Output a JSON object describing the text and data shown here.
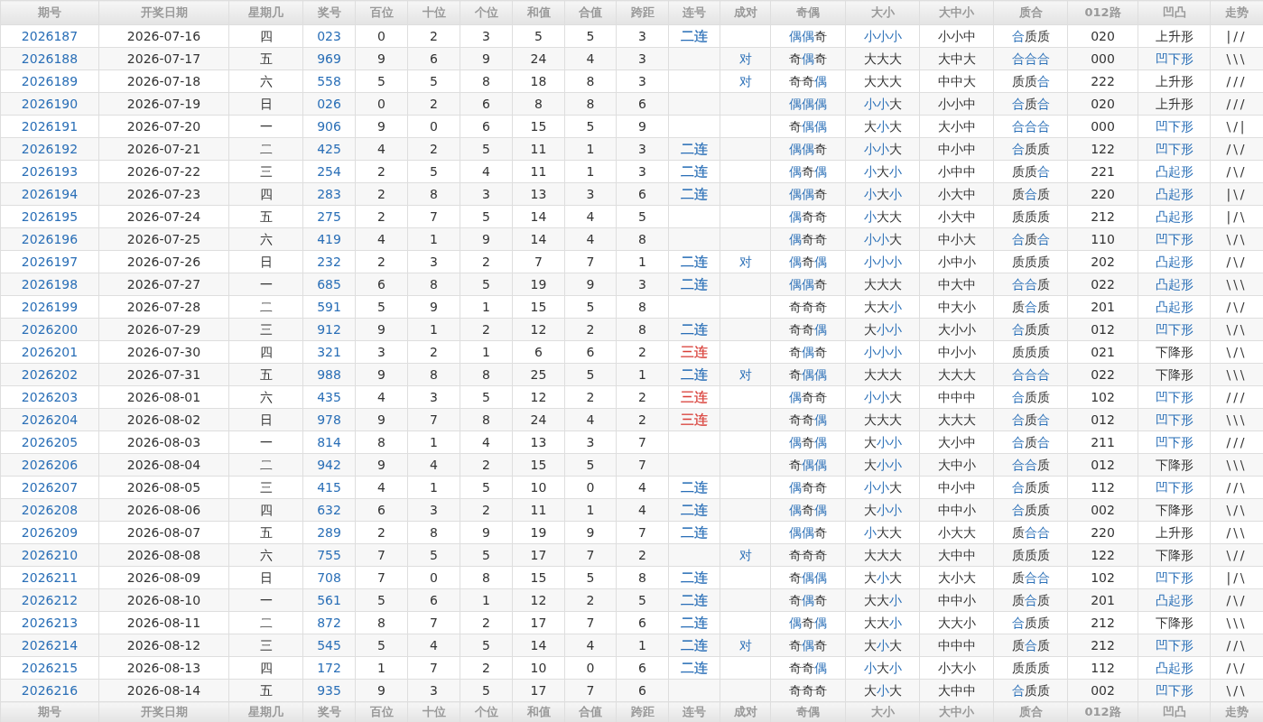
{
  "header": [
    "期号",
    "开奖日期",
    "星期几",
    "奖号",
    "百位",
    "十位",
    "个位",
    "和值",
    "合值",
    "跨距",
    "连号",
    "成对",
    "奇偶",
    "大小",
    "大中小",
    "质合",
    "012路",
    "凹凸",
    "走势"
  ],
  "rows": [
    {
      "period": "2026187",
      "date": "2026-07-16",
      "weekday": "四",
      "number": "023",
      "hundreds": "0",
      "tens": "2",
      "units": "3",
      "sum": "5",
      "sum_tail": "5",
      "span": "3",
      "consecutive": {
        "text": "二连",
        "color": "#2a6fb7"
      },
      "parity": "偶偶奇",
      "parity_marks": [
        true,
        true,
        false
      ],
      "size": "小小小",
      "size_marks": [
        true,
        true,
        true
      ],
      "size3": "小小中",
      "prime": "合质质",
      "prime_marks": [
        true,
        false,
        false
      ],
      "route012": "020",
      "shape": {
        "text": "上升形",
        "color": "#333333"
      },
      "trend": "|//"
    },
    {
      "period": "2026188",
      "date": "2026-07-17",
      "weekday": "五",
      "number": "969",
      "hundreds": "9",
      "tens": "6",
      "units": "9",
      "sum": "24",
      "sum_tail": "4",
      "span": "3",
      "pair": "对",
      "parity": "奇偶奇",
      "parity_marks": [
        false,
        true,
        false
      ],
      "size": "大大大",
      "size_marks": [
        false,
        false,
        false
      ],
      "size3": "大中大",
      "prime": "合合合",
      "prime_marks": [
        true,
        true,
        true
      ],
      "route012": "000",
      "shape": {
        "text": "凹下形",
        "color": "#2a6fb7"
      },
      "trend": "\\\\\\"
    },
    {
      "period": "2026189",
      "date": "2026-07-18",
      "weekday": "六",
      "number": "558",
      "hundreds": "5",
      "tens": "5",
      "units": "8",
      "sum": "18",
      "sum_tail": "8",
      "span": "3",
      "pair": "对",
      "parity": "奇奇偶",
      "parity_marks": [
        false,
        false,
        true
      ],
      "size": "大大大",
      "size_marks": [
        false,
        false,
        false
      ],
      "size3": "中中大",
      "prime": "质质合",
      "prime_marks": [
        false,
        false,
        true
      ],
      "route012": "222",
      "shape": {
        "text": "上升形",
        "color": "#333333"
      },
      "trend": "///"
    },
    {
      "period": "2026190",
      "date": "2026-07-19",
      "weekday": "日",
      "number": "026",
      "hundreds": "0",
      "tens": "2",
      "units": "6",
      "sum": "8",
      "sum_tail": "8",
      "span": "6",
      "parity": "偶偶偶",
      "parity_marks": [
        true,
        true,
        true
      ],
      "size": "小小大",
      "size_marks": [
        true,
        true,
        false
      ],
      "size3": "小小中",
      "prime": "合质合",
      "prime_marks": [
        true,
        false,
        true
      ],
      "route012": "020",
      "shape": {
        "text": "上升形",
        "color": "#333333"
      },
      "trend": "///"
    },
    {
      "period": "2026191",
      "date": "2026-07-20",
      "weekday": "一",
      "number": "906",
      "hundreds": "9",
      "tens": "0",
      "units": "6",
      "sum": "15",
      "sum_tail": "5",
      "span": "9",
      "parity": "奇偶偶",
      "parity_marks": [
        false,
        true,
        true
      ],
      "size": "大小大",
      "size_marks": [
        false,
        true,
        false
      ],
      "size3": "大小中",
      "prime": "合合合",
      "prime_marks": [
        true,
        true,
        true
      ],
      "route012": "000",
      "shape": {
        "text": "凹下形",
        "color": "#2a6fb7"
      },
      "trend": "\\/|"
    },
    {
      "period": "2026192",
      "date": "2026-07-21",
      "weekday": "二",
      "number": "425",
      "hundreds": "4",
      "tens": "2",
      "units": "5",
      "sum": "11",
      "sum_tail": "1",
      "span": "3",
      "consecutive": {
        "text": "二连",
        "color": "#2a6fb7"
      },
      "parity": "偶偶奇",
      "parity_marks": [
        true,
        true,
        false
      ],
      "size": "小小大",
      "size_marks": [
        true,
        true,
        false
      ],
      "size3": "中小中",
      "prime": "合质质",
      "prime_marks": [
        true,
        false,
        false
      ],
      "route012": "122",
      "shape": {
        "text": "凹下形",
        "color": "#2a6fb7"
      },
      "trend": "/\\/"
    },
    {
      "period": "2026193",
      "date": "2026-07-22",
      "weekday": "三",
      "number": "254",
      "hundreds": "2",
      "tens": "5",
      "units": "4",
      "sum": "11",
      "sum_tail": "1",
      "span": "3",
      "consecutive": {
        "text": "二连",
        "color": "#2a6fb7"
      },
      "parity": "偶奇偶",
      "parity_marks": [
        true,
        false,
        true
      ],
      "size": "小大小",
      "size_marks": [
        true,
        false,
        true
      ],
      "size3": "小中中",
      "prime": "质质合",
      "prime_marks": [
        false,
        false,
        true
      ],
      "route012": "221",
      "shape": {
        "text": "凸起形",
        "color": "#2a6fb7"
      },
      "trend": "/\\/"
    },
    {
      "period": "2026194",
      "date": "2026-07-23",
      "weekday": "四",
      "number": "283",
      "hundreds": "2",
      "tens": "8",
      "units": "3",
      "sum": "13",
      "sum_tail": "3",
      "span": "6",
      "consecutive": {
        "text": "二连",
        "color": "#2a6fb7"
      },
      "parity": "偶偶奇",
      "parity_marks": [
        true,
        true,
        false
      ],
      "size": "小大小",
      "size_marks": [
        true,
        false,
        true
      ],
      "size3": "小大中",
      "prime": "质合质",
      "prime_marks": [
        false,
        true,
        false
      ],
      "route012": "220",
      "shape": {
        "text": "凸起形",
        "color": "#2a6fb7"
      },
      "trend": "|\\/"
    },
    {
      "period": "2026195",
      "date": "2026-07-24",
      "weekday": "五",
      "number": "275",
      "hundreds": "2",
      "tens": "7",
      "units": "5",
      "sum": "14",
      "sum_tail": "4",
      "span": "5",
      "parity": "偶奇奇",
      "parity_marks": [
        true,
        false,
        false
      ],
      "size": "小大大",
      "size_marks": [
        true,
        false,
        false
      ],
      "size3": "小大中",
      "prime": "质质质",
      "prime_marks": [
        false,
        false,
        false
      ],
      "route012": "212",
      "shape": {
        "text": "凸起形",
        "color": "#2a6fb7"
      },
      "trend": "|/\\"
    },
    {
      "period": "2026196",
      "date": "2026-07-25",
      "weekday": "六",
      "number": "419",
      "hundreds": "4",
      "tens": "1",
      "units": "9",
      "sum": "14",
      "sum_tail": "4",
      "span": "8",
      "parity": "偶奇奇",
      "parity_marks": [
        true,
        false,
        false
      ],
      "size": "小小大",
      "size_marks": [
        true,
        true,
        false
      ],
      "size3": "中小大",
      "prime": "合质合",
      "prime_marks": [
        true,
        false,
        true
      ],
      "route012": "110",
      "shape": {
        "text": "凹下形",
        "color": "#2a6fb7"
      },
      "trend": "\\/\\"
    },
    {
      "period": "2026197",
      "date": "2026-07-26",
      "weekday": "日",
      "number": "232",
      "hundreds": "2",
      "tens": "3",
      "units": "2",
      "sum": "7",
      "sum_tail": "7",
      "span": "1",
      "consecutive": {
        "text": "二连",
        "color": "#2a6fb7"
      },
      "pair": "对",
      "parity": "偶奇偶",
      "parity_marks": [
        true,
        false,
        true
      ],
      "size": "小小小",
      "size_marks": [
        true,
        true,
        true
      ],
      "size3": "小中小",
      "prime": "质质质",
      "prime_marks": [
        false,
        false,
        false
      ],
      "route012": "202",
      "shape": {
        "text": "凸起形",
        "color": "#2a6fb7"
      },
      "trend": "/\\/"
    },
    {
      "period": "2026198",
      "date": "2026-07-27",
      "weekday": "一",
      "number": "685",
      "hundreds": "6",
      "tens": "8",
      "units": "5",
      "sum": "19",
      "sum_tail": "9",
      "span": "3",
      "consecutive": {
        "text": "二连",
        "color": "#2a6fb7"
      },
      "parity": "偶偶奇",
      "parity_marks": [
        true,
        true,
        false
      ],
      "size": "大大大",
      "size_marks": [
        false,
        false,
        false
      ],
      "size3": "中大中",
      "prime": "合合质",
      "prime_marks": [
        true,
        true,
        false
      ],
      "route012": "022",
      "shape": {
        "text": "凸起形",
        "color": "#2a6fb7"
      },
      "trend": "\\\\\\"
    },
    {
      "period": "2026199",
      "date": "2026-07-28",
      "weekday": "二",
      "number": "591",
      "hundreds": "5",
      "tens": "9",
      "units": "1",
      "sum": "15",
      "sum_tail": "5",
      "span": "8",
      "parity": "奇奇奇",
      "parity_marks": [
        false,
        false,
        false
      ],
      "size": "大大小",
      "size_marks": [
        false,
        false,
        true
      ],
      "size3": "中大小",
      "prime": "质合质",
      "prime_marks": [
        false,
        true,
        false
      ],
      "route012": "201",
      "shape": {
        "text": "凸起形",
        "color": "#2a6fb7"
      },
      "trend": "/\\/"
    },
    {
      "period": "2026200",
      "date": "2026-07-29",
      "weekday": "三",
      "number": "912",
      "hundreds": "9",
      "tens": "1",
      "units": "2",
      "sum": "12",
      "sum_tail": "2",
      "span": "8",
      "consecutive": {
        "text": "二连",
        "color": "#2a6fb7"
      },
      "parity": "奇奇偶",
      "parity_marks": [
        false,
        false,
        true
      ],
      "size": "大小小",
      "size_marks": [
        false,
        true,
        true
      ],
      "size3": "大小小",
      "prime": "合质质",
      "prime_marks": [
        true,
        false,
        false
      ],
      "route012": "012",
      "shape": {
        "text": "凹下形",
        "color": "#2a6fb7"
      },
      "trend": "\\/\\"
    },
    {
      "period": "2026201",
      "date": "2026-07-30",
      "weekday": "四",
      "number": "321",
      "hundreds": "3",
      "tens": "2",
      "units": "1",
      "sum": "6",
      "sum_tail": "6",
      "span": "2",
      "consecutive": {
        "text": "三连",
        "color": "#d9403a"
      },
      "parity": "奇偶奇",
      "parity_marks": [
        false,
        true,
        false
      ],
      "size": "小小小",
      "size_marks": [
        true,
        true,
        true
      ],
      "size3": "中小小",
      "prime": "质质质",
      "prime_marks": [
        false,
        false,
        false
      ],
      "route012": "021",
      "shape": {
        "text": "下降形",
        "color": "#333333"
      },
      "trend": "\\/\\"
    },
    {
      "period": "2026202",
      "date": "2026-07-31",
      "weekday": "五",
      "number": "988",
      "hundreds": "9",
      "tens": "8",
      "units": "8",
      "sum": "25",
      "sum_tail": "5",
      "span": "1",
      "consecutive": {
        "text": "二连",
        "color": "#2a6fb7"
      },
      "pair": "对",
      "parity": "奇偶偶",
      "parity_marks": [
        false,
        true,
        true
      ],
      "size": "大大大",
      "size_marks": [
        false,
        false,
        false
      ],
      "size3": "大大大",
      "prime": "合合合",
      "prime_marks": [
        true,
        true,
        true
      ],
      "route012": "022",
      "shape": {
        "text": "下降形",
        "color": "#333333"
      },
      "trend": "\\\\\\"
    },
    {
      "period": "2026203",
      "date": "2026-08-01",
      "weekday": "六",
      "number": "435",
      "hundreds": "4",
      "tens": "3",
      "units": "5",
      "sum": "12",
      "sum_tail": "2",
      "span": "2",
      "consecutive": {
        "text": "三连",
        "color": "#d9403a"
      },
      "parity": "偶奇奇",
      "parity_marks": [
        true,
        false,
        false
      ],
      "size": "小小大",
      "size_marks": [
        true,
        true,
        false
      ],
      "size3": "中中中",
      "prime": "合质质",
      "prime_marks": [
        true,
        false,
        false
      ],
      "route012": "102",
      "shape": {
        "text": "凹下形",
        "color": "#2a6fb7"
      },
      "trend": "///"
    },
    {
      "period": "2026204",
      "date": "2026-08-02",
      "weekday": "日",
      "number": "978",
      "hundreds": "9",
      "tens": "7",
      "units": "8",
      "sum": "24",
      "sum_tail": "4",
      "span": "2",
      "consecutive": {
        "text": "三连",
        "color": "#d9403a"
      },
      "parity": "奇奇偶",
      "parity_marks": [
        false,
        false,
        true
      ],
      "size": "大大大",
      "size_marks": [
        false,
        false,
        false
      ],
      "size3": "大大大",
      "prime": "合质合",
      "prime_marks": [
        true,
        false,
        true
      ],
      "route012": "012",
      "shape": {
        "text": "凹下形",
        "color": "#2a6fb7"
      },
      "trend": "\\\\\\"
    },
    {
      "period": "2026205",
      "date": "2026-08-03",
      "weekday": "一",
      "number": "814",
      "hundreds": "8",
      "tens": "1",
      "units": "4",
      "sum": "13",
      "sum_tail": "3",
      "span": "7",
      "parity": "偶奇偶",
      "parity_marks": [
        true,
        false,
        true
      ],
      "size": "大小小",
      "size_marks": [
        false,
        true,
        true
      ],
      "size3": "大小中",
      "prime": "合质合",
      "prime_marks": [
        true,
        false,
        true
      ],
      "route012": "211",
      "shape": {
        "text": "凹下形",
        "color": "#2a6fb7"
      },
      "trend": "///"
    },
    {
      "period": "2026206",
      "date": "2026-08-04",
      "weekday": "二",
      "number": "942",
      "hundreds": "9",
      "tens": "4",
      "units": "2",
      "sum": "15",
      "sum_tail": "5",
      "span": "7",
      "parity": "奇偶偶",
      "parity_marks": [
        false,
        true,
        true
      ],
      "size": "大小小",
      "size_marks": [
        false,
        true,
        true
      ],
      "size3": "大中小",
      "prime": "合合质",
      "prime_marks": [
        true,
        true,
        false
      ],
      "route012": "012",
      "shape": {
        "text": "下降形",
        "color": "#333333"
      },
      "trend": "\\\\\\"
    },
    {
      "period": "2026207",
      "date": "2026-08-05",
      "weekday": "三",
      "number": "415",
      "hundreds": "4",
      "tens": "1",
      "units": "5",
      "sum": "10",
      "sum_tail": "0",
      "span": "4",
      "consecutive": {
        "text": "二连",
        "color": "#2a6fb7"
      },
      "parity": "偶奇奇",
      "parity_marks": [
        true,
        false,
        false
      ],
      "size": "小小大",
      "size_marks": [
        true,
        true,
        false
      ],
      "size3": "中小中",
      "prime": "合质质",
      "prime_marks": [
        true,
        false,
        false
      ],
      "route012": "112",
      "shape": {
        "text": "凹下形",
        "color": "#2a6fb7"
      },
      "trend": "//\\"
    },
    {
      "period": "2026208",
      "date": "2026-08-06",
      "weekday": "四",
      "number": "632",
      "hundreds": "6",
      "tens": "3",
      "units": "2",
      "sum": "11",
      "sum_tail": "1",
      "span": "4",
      "consecutive": {
        "text": "二连",
        "color": "#2a6fb7"
      },
      "parity": "偶奇偶",
      "parity_marks": [
        true,
        false,
        true
      ],
      "size": "大小小",
      "size_marks": [
        false,
        true,
        true
      ],
      "size3": "中中小",
      "prime": "合质质",
      "prime_marks": [
        true,
        false,
        false
      ],
      "route012": "002",
      "shape": {
        "text": "下降形",
        "color": "#333333"
      },
      "trend": "\\/\\"
    },
    {
      "period": "2026209",
      "date": "2026-08-07",
      "weekday": "五",
      "number": "289",
      "hundreds": "2",
      "tens": "8",
      "units": "9",
      "sum": "19",
      "sum_tail": "9",
      "span": "7",
      "consecutive": {
        "text": "二连",
        "color": "#2a6fb7"
      },
      "parity": "偶偶奇",
      "parity_marks": [
        true,
        true,
        false
      ],
      "size": "小大大",
      "size_marks": [
        true,
        false,
        false
      ],
      "size3": "小大大",
      "prime": "质合合",
      "prime_marks": [
        false,
        true,
        true
      ],
      "route012": "220",
      "shape": {
        "text": "上升形",
        "color": "#333333"
      },
      "trend": "/\\\\"
    },
    {
      "period": "2026210",
      "date": "2026-08-08",
      "weekday": "六",
      "number": "755",
      "hundreds": "7",
      "tens": "5",
      "units": "5",
      "sum": "17",
      "sum_tail": "7",
      "span": "2",
      "pair": "对",
      "parity": "奇奇奇",
      "parity_marks": [
        false,
        false,
        false
      ],
      "size": "大大大",
      "size_marks": [
        false,
        false,
        false
      ],
      "size3": "大中中",
      "prime": "质质质",
      "prime_marks": [
        false,
        false,
        false
      ],
      "route012": "122",
      "shape": {
        "text": "下降形",
        "color": "#333333"
      },
      "trend": "\\//"
    },
    {
      "period": "2026211",
      "date": "2026-08-09",
      "weekday": "日",
      "number": "708",
      "hundreds": "7",
      "tens": "0",
      "units": "8",
      "sum": "15",
      "sum_tail": "5",
      "span": "8",
      "consecutive": {
        "text": "二连",
        "color": "#2a6fb7"
      },
      "parity": "奇偶偶",
      "parity_marks": [
        false,
        true,
        true
      ],
      "size": "大小大",
      "size_marks": [
        false,
        true,
        false
      ],
      "size3": "大小大",
      "prime": "质合合",
      "prime_marks": [
        false,
        true,
        true
      ],
      "route012": "102",
      "shape": {
        "text": "凹下形",
        "color": "#2a6fb7"
      },
      "trend": "|/\\"
    },
    {
      "period": "2026212",
      "date": "2026-08-10",
      "weekday": "一",
      "number": "561",
      "hundreds": "5",
      "tens": "6",
      "units": "1",
      "sum": "12",
      "sum_tail": "2",
      "span": "5",
      "consecutive": {
        "text": "二连",
        "color": "#2a6fb7"
      },
      "parity": "奇偶奇",
      "parity_marks": [
        false,
        true,
        false
      ],
      "size": "大大小",
      "size_marks": [
        false,
        false,
        true
      ],
      "size3": "中中小",
      "prime": "质合质",
      "prime_marks": [
        false,
        true,
        false
      ],
      "route012": "201",
      "shape": {
        "text": "凸起形",
        "color": "#2a6fb7"
      },
      "trend": "/\\/"
    },
    {
      "period": "2026213",
      "date": "2026-08-11",
      "weekday": "二",
      "number": "872",
      "hundreds": "8",
      "tens": "7",
      "units": "2",
      "sum": "17",
      "sum_tail": "7",
      "span": "6",
      "consecutive": {
        "text": "二连",
        "color": "#2a6fb7"
      },
      "parity": "偶奇偶",
      "parity_marks": [
        true,
        false,
        true
      ],
      "size": "大大小",
      "size_marks": [
        false,
        false,
        true
      ],
      "size3": "大大小",
      "prime": "合质质",
      "prime_marks": [
        true,
        false,
        false
      ],
      "route012": "212",
      "shape": {
        "text": "下降形",
        "color": "#333333"
      },
      "trend": "\\\\\\"
    },
    {
      "period": "2026214",
      "date": "2026-08-12",
      "weekday": "三",
      "number": "545",
      "hundreds": "5",
      "tens": "4",
      "units": "5",
      "sum": "14",
      "sum_tail": "4",
      "span": "1",
      "consecutive": {
        "text": "二连",
        "color": "#2a6fb7"
      },
      "pair": "对",
      "parity": "奇偶奇",
      "parity_marks": [
        false,
        true,
        false
      ],
      "size": "大小大",
      "size_marks": [
        false,
        true,
        false
      ],
      "size3": "中中中",
      "prime": "质合质",
      "prime_marks": [
        false,
        true,
        false
      ],
      "route012": "212",
      "shape": {
        "text": "凹下形",
        "color": "#2a6fb7"
      },
      "trend": "//\\"
    },
    {
      "period": "2026215",
      "date": "2026-08-13",
      "weekday": "四",
      "number": "172",
      "hundreds": "1",
      "tens": "7",
      "units": "2",
      "sum": "10",
      "sum_tail": "0",
      "span": "6",
      "consecutive": {
        "text": "二连",
        "color": "#2a6fb7"
      },
      "parity": "奇奇偶",
      "parity_marks": [
        false,
        false,
        true
      ],
      "size": "小大小",
      "size_marks": [
        true,
        false,
        true
      ],
      "size3": "小大小",
      "prime": "质质质",
      "prime_marks": [
        false,
        false,
        false
      ],
      "route012": "112",
      "shape": {
        "text": "凸起形",
        "color": "#2a6fb7"
      },
      "trend": "/\\/"
    },
    {
      "period": "2026216",
      "date": "2026-08-14",
      "weekday": "五",
      "number": "935",
      "hundreds": "9",
      "tens": "3",
      "units": "5",
      "sum": "17",
      "sum_tail": "7",
      "span": "6",
      "parity": "奇奇奇",
      "parity_marks": [
        false,
        false,
        false
      ],
      "size": "大小大",
      "size_marks": [
        false,
        true,
        false
      ],
      "size3": "大中中",
      "prime": "合质质",
      "prime_marks": [
        true,
        false,
        false
      ],
      "route012": "002",
      "shape": {
        "text": "凹下形",
        "color": "#2a6fb7"
      },
      "trend": "\\/\\"
    }
  ],
  "footer": [
    "期号",
    "开奖日期",
    "星期几",
    "奖号",
    "百位",
    "十位",
    "个位",
    "和值",
    "合值",
    "跨距",
    "连号",
    "成对",
    "奇偶",
    "大小",
    "大中小",
    "质合",
    "012路",
    "凹凸",
    "走势"
  ]
}
